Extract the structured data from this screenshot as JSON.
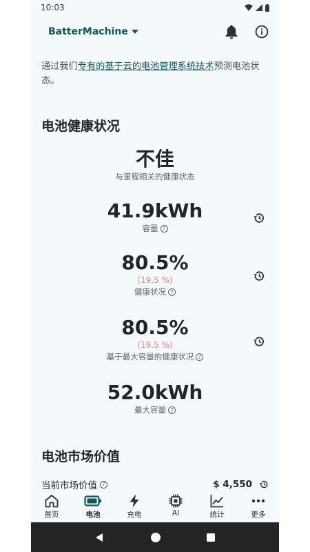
{
  "status": {
    "time": "10:03"
  },
  "app": {
    "title": "BatterMachine"
  },
  "intro": {
    "prefix": "通过我们",
    "link": "专有的基于云的电池管理系统技术",
    "suffix": "预测电池状态。"
  },
  "health": {
    "section_title": "电池健康状况",
    "overall": {
      "value": "不佳",
      "label": "与里程相关的健康状态"
    },
    "capacity": {
      "value": "41.9kWh",
      "label": "容量"
    },
    "soh": {
      "value": "80.5%",
      "delta": "(19.5 %)",
      "label": "健康状况"
    },
    "soh_max": {
      "value": "80.5%",
      "delta": "(19.5 %)",
      "label": "基于最大容量的健康状况"
    },
    "max_capacity": {
      "value": "52.0kWh",
      "label": "最大容量"
    }
  },
  "market": {
    "section_title": "电池市场价值",
    "current_label": "当前市场价值",
    "current_value": "$ 4,550"
  },
  "nav": {
    "items": [
      {
        "label": "首页",
        "icon": "home-icon"
      },
      {
        "label": "电池",
        "icon": "battery-icon"
      },
      {
        "label": "充电",
        "icon": "bolt-icon"
      },
      {
        "label": "AI",
        "icon": "chip-icon"
      },
      {
        "label": "统计",
        "icon": "chart-icon"
      },
      {
        "label": "更多",
        "icon": "more-icon"
      }
    ],
    "active": "电池"
  },
  "colors": {
    "accent": "#0c5a5d",
    "negative": "#e87f86",
    "background": "#f4f9fb"
  }
}
